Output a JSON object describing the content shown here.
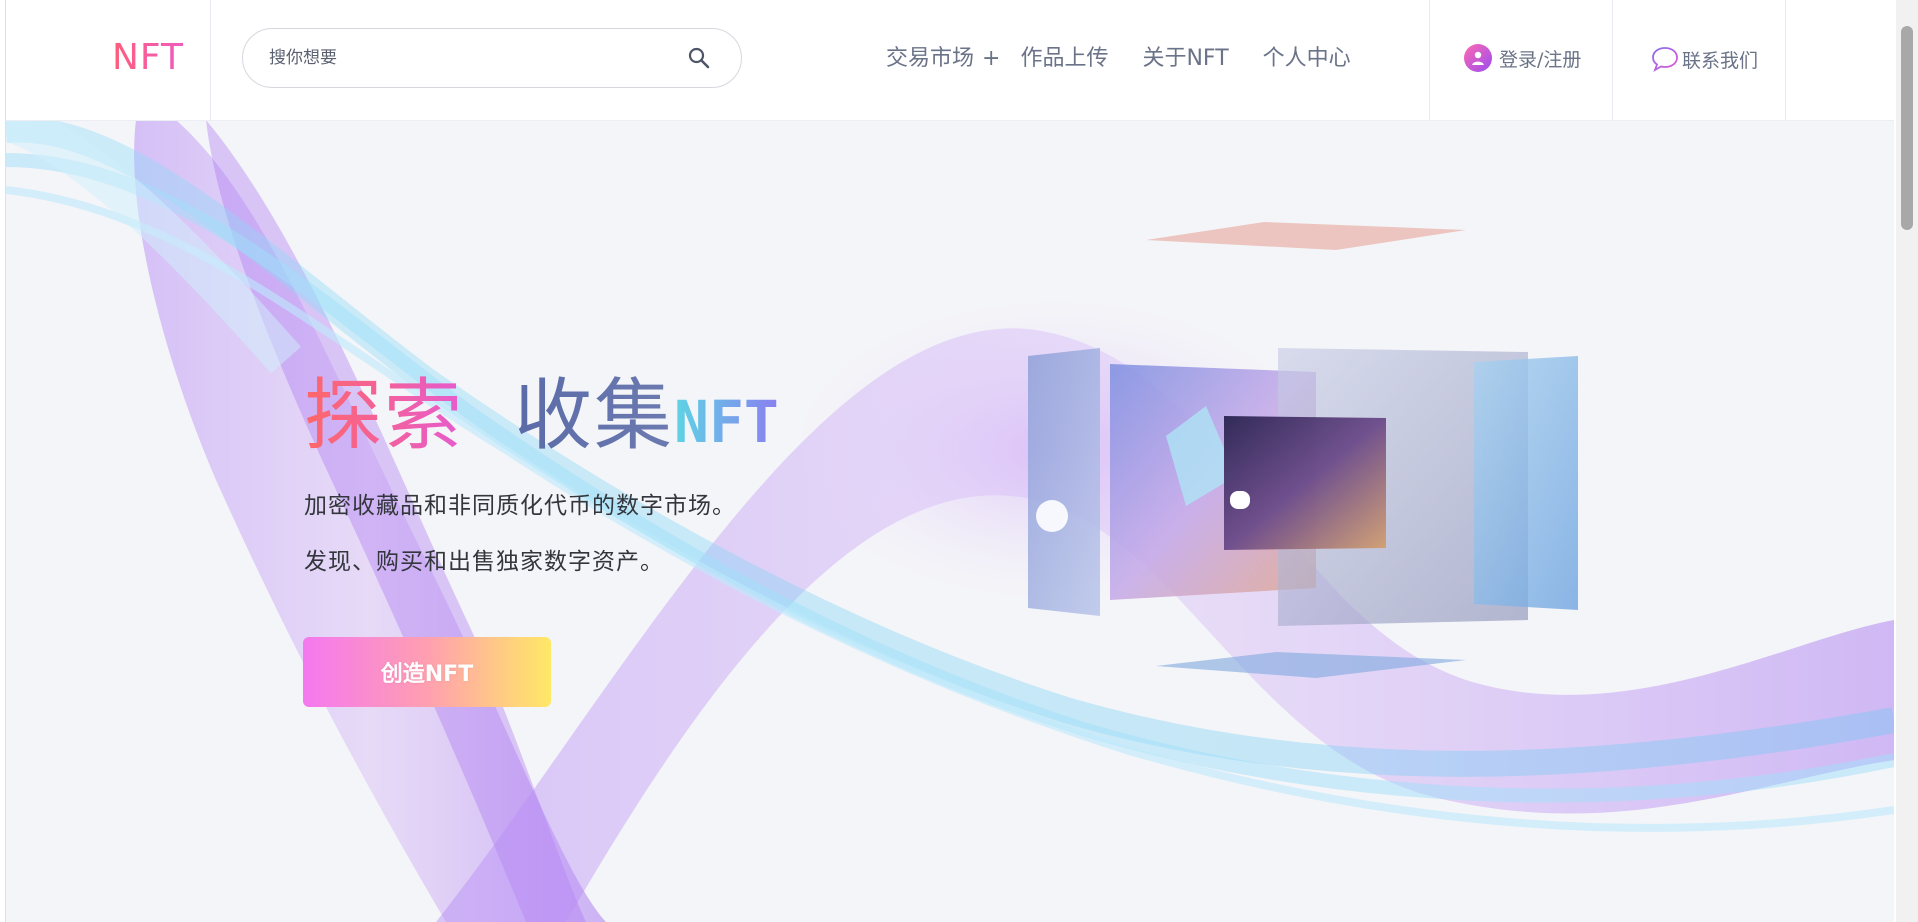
{
  "header": {
    "logo": "NFT",
    "search": {
      "placeholder": "搜你想要",
      "value": ""
    },
    "nav": {
      "market": "交易市场",
      "market_expand": "+",
      "upload": "作品上传",
      "about": "关于NFT",
      "personal": "个人中心"
    },
    "login": "登录/注册",
    "contact": "联系我们"
  },
  "hero": {
    "headline_1": "探索",
    "headline_2": "收集",
    "headline_3": "NFT",
    "subtitle_1": "加密收藏品和非同质化代币的数字市场。",
    "subtitle_2": "发现、购买和出售独家数字资产。",
    "cta": "创造NFT"
  },
  "theme": {
    "accent_pink": "#f478f0",
    "accent_yellow": "#ffe866",
    "wave_purple": "#a56cf0",
    "wave_cyan": "#7fd3f5",
    "nav_text": "#6a7388"
  },
  "icons": {
    "search": "magnifier-icon",
    "user": "user-avatar-icon",
    "chat": "speech-bubble-icon"
  }
}
